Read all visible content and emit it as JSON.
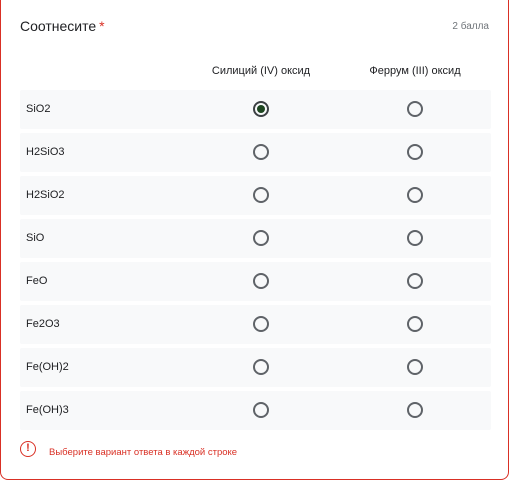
{
  "question": {
    "title": "Соотнесите",
    "required_marker": "*",
    "points": "2 балла"
  },
  "columns": [
    "Силиций (IV) оксид",
    "Феррум (III) оксид"
  ],
  "rows": [
    {
      "label": "SiO2",
      "selected": 0
    },
    {
      "label": "H2SiO3",
      "selected": null
    },
    {
      "label": "H2SiO2",
      "selected": null
    },
    {
      "label": "SiO",
      "selected": null
    },
    {
      "label": "FeO",
      "selected": null
    },
    {
      "label": "Fe2O3",
      "selected": null
    },
    {
      "label": "Fe(OH)2",
      "selected": null
    },
    {
      "label": "Fe(OH)3",
      "selected": null
    }
  ],
  "error": {
    "icon": "error-icon",
    "glyph": "!",
    "message": "Выберите вариант ответа в каждой строке"
  },
  "colors": {
    "error": "#d93025",
    "selected_radio": "#1e4620",
    "row_background": "#f8f9fa"
  }
}
